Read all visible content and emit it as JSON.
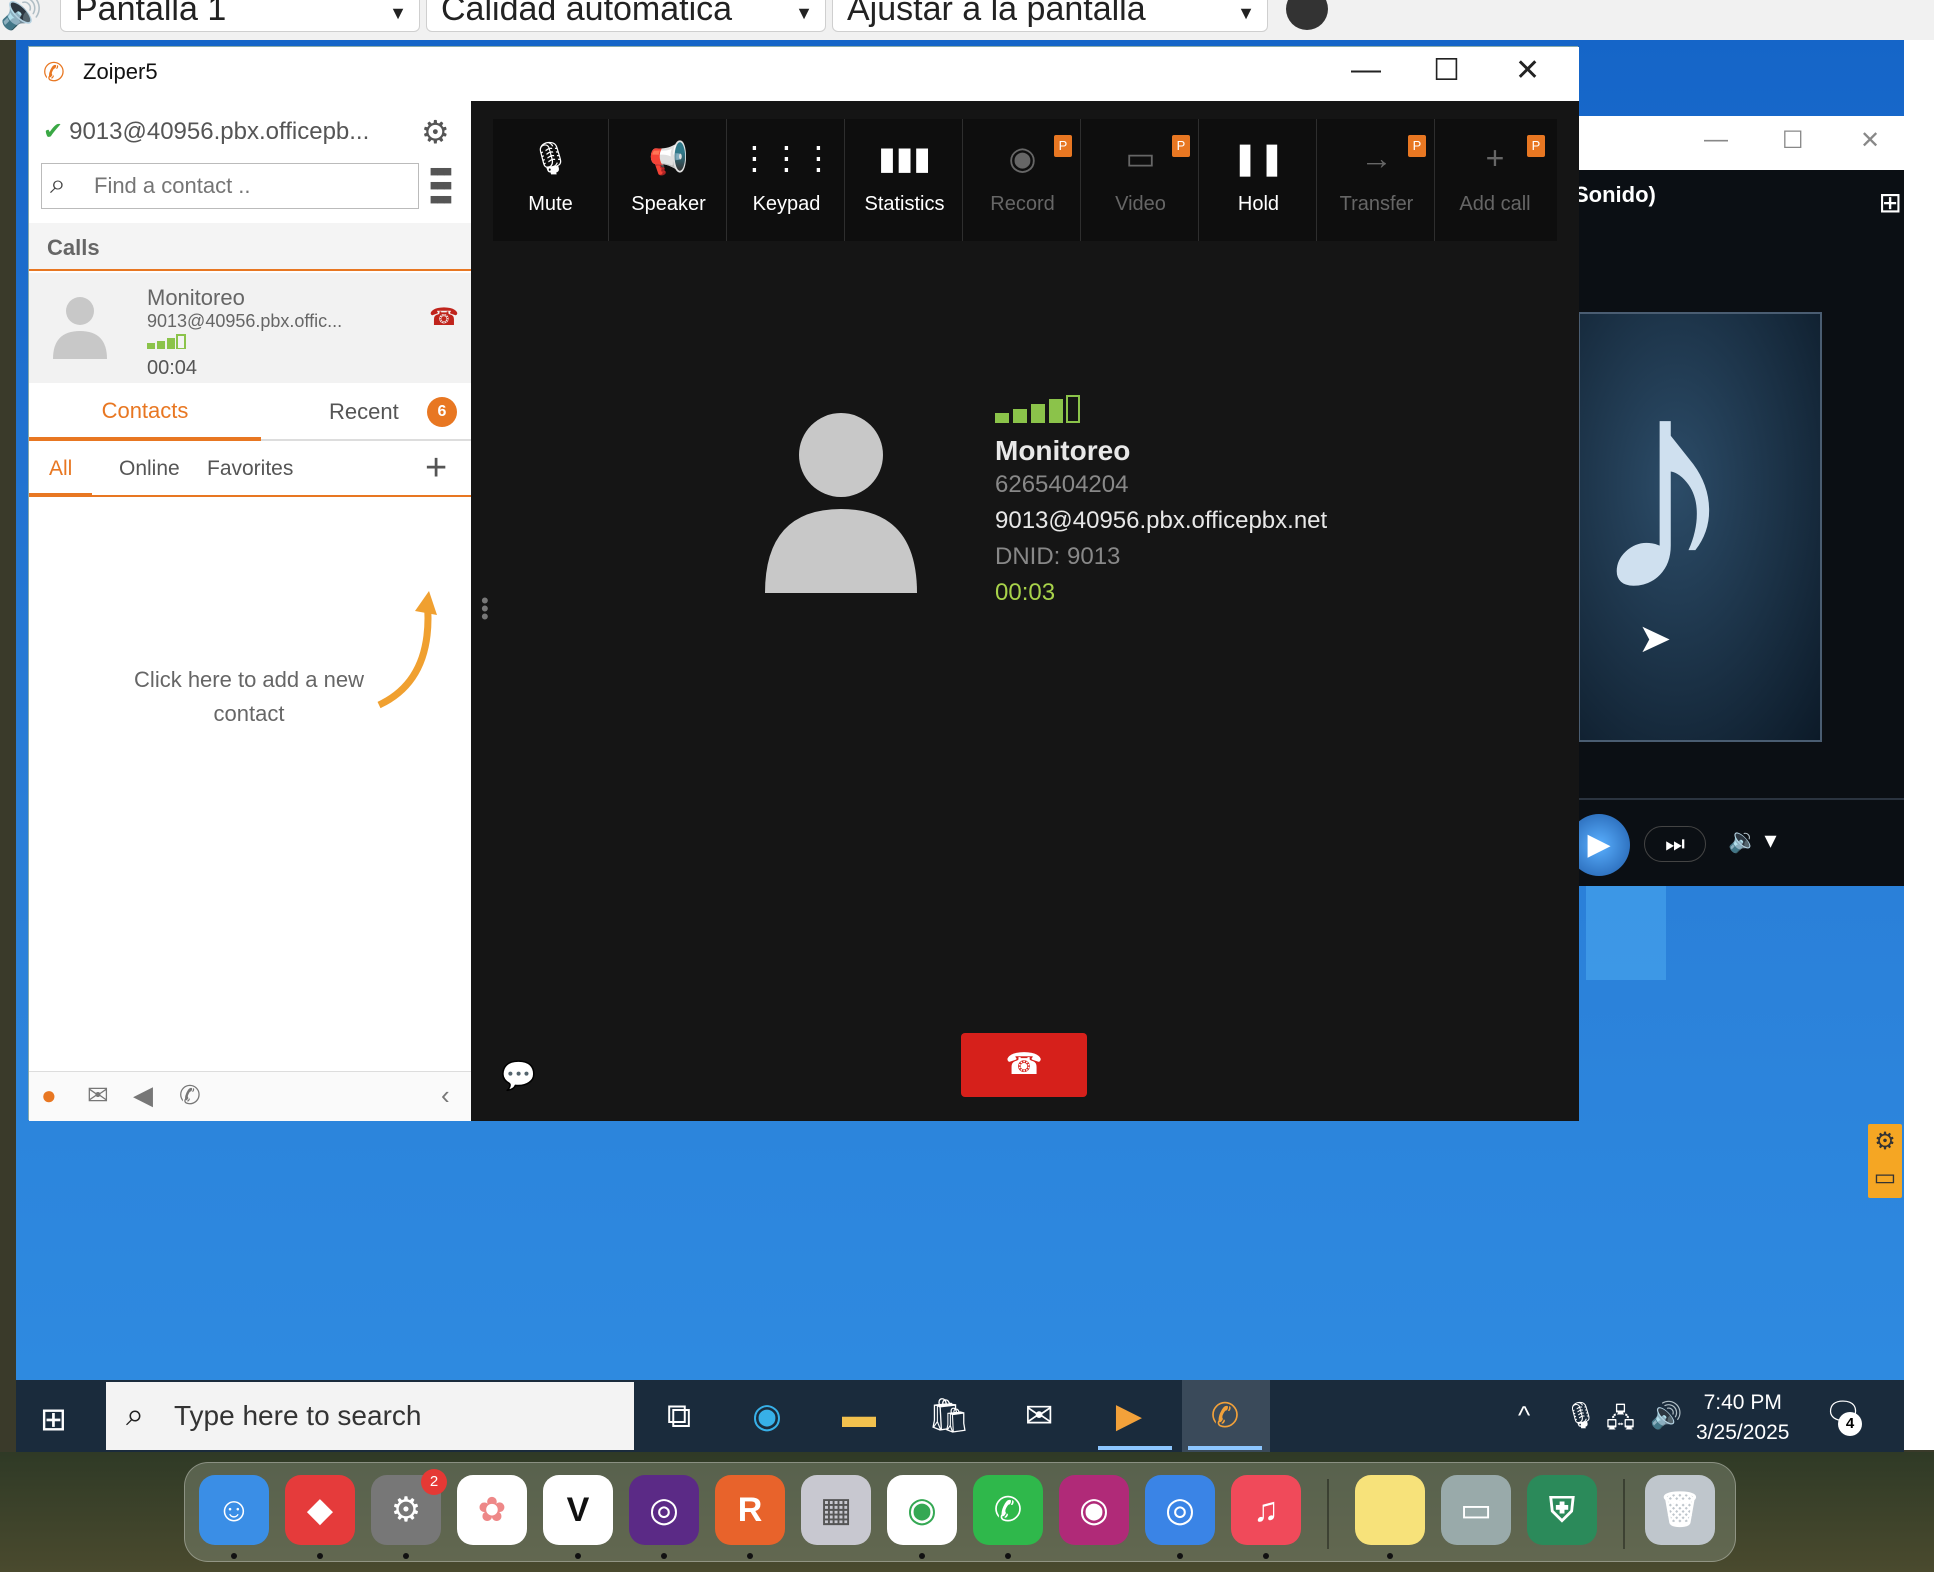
{
  "remote_bar": {
    "display_select": "Pantalla 1",
    "quality_select": "Calidad automática",
    "fit_select": "Ajustar a la pantalla"
  },
  "zoiper": {
    "title": "Zoiper5",
    "account": "9013@40956.pbx.officepb...",
    "search_placeholder": "Find a contact ..",
    "calls_header": "Calls",
    "call": {
      "name": "Monitoreo",
      "address": "9013@40956.pbx.offic...",
      "duration": "00:04"
    },
    "tabs": {
      "contacts": "Contacts",
      "recent": "Recent",
      "recent_badge": "6"
    },
    "filters": {
      "all": "All",
      "online": "Online",
      "favorites": "Favorites"
    },
    "empty_hint": "Click here to add a new contact",
    "toolbar": [
      {
        "label": "Mute",
        "icon": "mic-off-icon",
        "state": "on",
        "pro": false
      },
      {
        "label": "Speaker",
        "icon": "speaker-icon",
        "state": "on",
        "pro": false
      },
      {
        "label": "Keypad",
        "icon": "keypad-icon",
        "state": "on",
        "pro": false
      },
      {
        "label": "Statistics",
        "icon": "statistics-icon",
        "state": "on",
        "pro": false
      },
      {
        "label": "Record",
        "icon": "record-icon",
        "state": "off",
        "pro": true
      },
      {
        "label": "Video",
        "icon": "video-icon",
        "state": "off",
        "pro": true
      },
      {
        "label": "Hold",
        "icon": "pause-icon",
        "state": "on",
        "pro": false
      },
      {
        "label": "Transfer",
        "icon": "transfer-icon",
        "state": "off",
        "pro": true
      },
      {
        "label": "Add call",
        "icon": "add-call-icon",
        "state": "off",
        "pro": true
      }
    ],
    "pro_badge": "P",
    "active_call": {
      "name": "Monitoreo",
      "number": "6265404204",
      "address": "9013@40956.pbx.officepbx.net",
      "dnid": "DNID: 9013",
      "timer": "00:03"
    },
    "colors": {
      "accent": "#e87722",
      "hangup": "#d6201b",
      "timer": "#a8d34a"
    }
  },
  "media_player": {
    "title": "Sonido)"
  },
  "taskbar": {
    "search_placeholder": "Type here to search",
    "time": "7:40 PM",
    "date": "3/25/2025",
    "notifications": "4"
  },
  "dock": {
    "settings_badge": "2"
  }
}
